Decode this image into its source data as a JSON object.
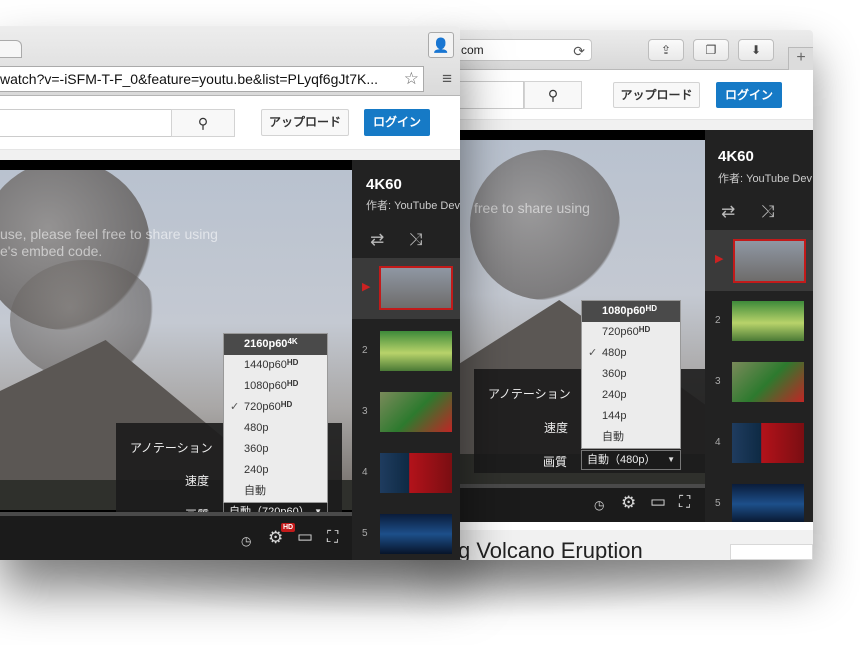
{
  "back_window": {
    "url_text": "com",
    "header": {
      "upload_label": "アップロード",
      "login_label": "ログイン"
    },
    "player": {
      "watermark": "free to share using",
      "settings": {
        "annotations_label": "アノテーション",
        "speed_label": "速度",
        "quality_label": "画質",
        "quality_value": "自動（480p）"
      },
      "quality_menu": [
        {
          "label": "1080p60",
          "badge": "HD",
          "highlighted": true,
          "checked": false
        },
        {
          "label": "720p60",
          "badge": "HD",
          "highlighted": false,
          "checked": false
        },
        {
          "label": "480p",
          "badge": "",
          "highlighted": false,
          "checked": true
        },
        {
          "label": "360p",
          "badge": "",
          "highlighted": false,
          "checked": false
        },
        {
          "label": "240p",
          "badge": "",
          "highlighted": false,
          "checked": false
        },
        {
          "label": "144p",
          "badge": "",
          "highlighted": false,
          "checked": false
        },
        {
          "label": "自動",
          "badge": "",
          "highlighted": false,
          "checked": false
        }
      ]
    },
    "playlist": {
      "title": "4K60",
      "author": "作者: YouTube Dev",
      "indices": [
        "2",
        "3",
        "4",
        "5"
      ]
    },
    "below_title": "g Volcano Eruption"
  },
  "front_window": {
    "url_text": "watch?v=-iSFM-T-F_0&feature=youtu.be&list=PLyqf6gJt7K...",
    "header": {
      "upload_label": "アップロード",
      "login_label": "ログイン"
    },
    "player": {
      "watermark_line1": "use, please feel free to share using",
      "watermark_line2": "e's embed code.",
      "hd_badge": "HD",
      "settings": {
        "annotations_label": "アノテーション",
        "speed_label": "速度",
        "quality_label": "画質",
        "quality_value": "自動（720p60）"
      },
      "quality_menu": [
        {
          "label": "2160p60",
          "badge": "4K",
          "highlighted": true,
          "checked": false
        },
        {
          "label": "1440p60",
          "badge": "HD",
          "highlighted": false,
          "checked": false
        },
        {
          "label": "1080p60",
          "badge": "HD",
          "highlighted": false,
          "checked": false
        },
        {
          "label": "720p60",
          "badge": "HD",
          "highlighted": false,
          "checked": true
        },
        {
          "label": "480p",
          "badge": "",
          "highlighted": false,
          "checked": false
        },
        {
          "label": "360p",
          "badge": "",
          "highlighted": false,
          "checked": false
        },
        {
          "label": "240p",
          "badge": "",
          "highlighted": false,
          "checked": false
        },
        {
          "label": "自動",
          "badge": "",
          "highlighted": false,
          "checked": false
        }
      ]
    },
    "playlist": {
      "title": "4K60",
      "author": "作者: YouTube Dev",
      "indices": [
        "2",
        "3",
        "4",
        "5"
      ]
    }
  },
  "icons": {
    "reload": "⟳",
    "share": "⇪",
    "tabs": "❐",
    "download": "⬇",
    "new_tab": "+",
    "search": "⚲",
    "repeat": "⇄",
    "shuffle": "⤨",
    "play_arrow": "▶",
    "clock": "◷",
    "gear": "⚙",
    "theater": "▭",
    "fullscreen": "⛶",
    "star": "☆",
    "menu": "≡",
    "profile": "👤",
    "check": "✓",
    "caret": "▼"
  },
  "colors": {
    "login_blue": "#167ac6",
    "playlist_bg": "#222222",
    "selected_red": "#c21a1a"
  }
}
